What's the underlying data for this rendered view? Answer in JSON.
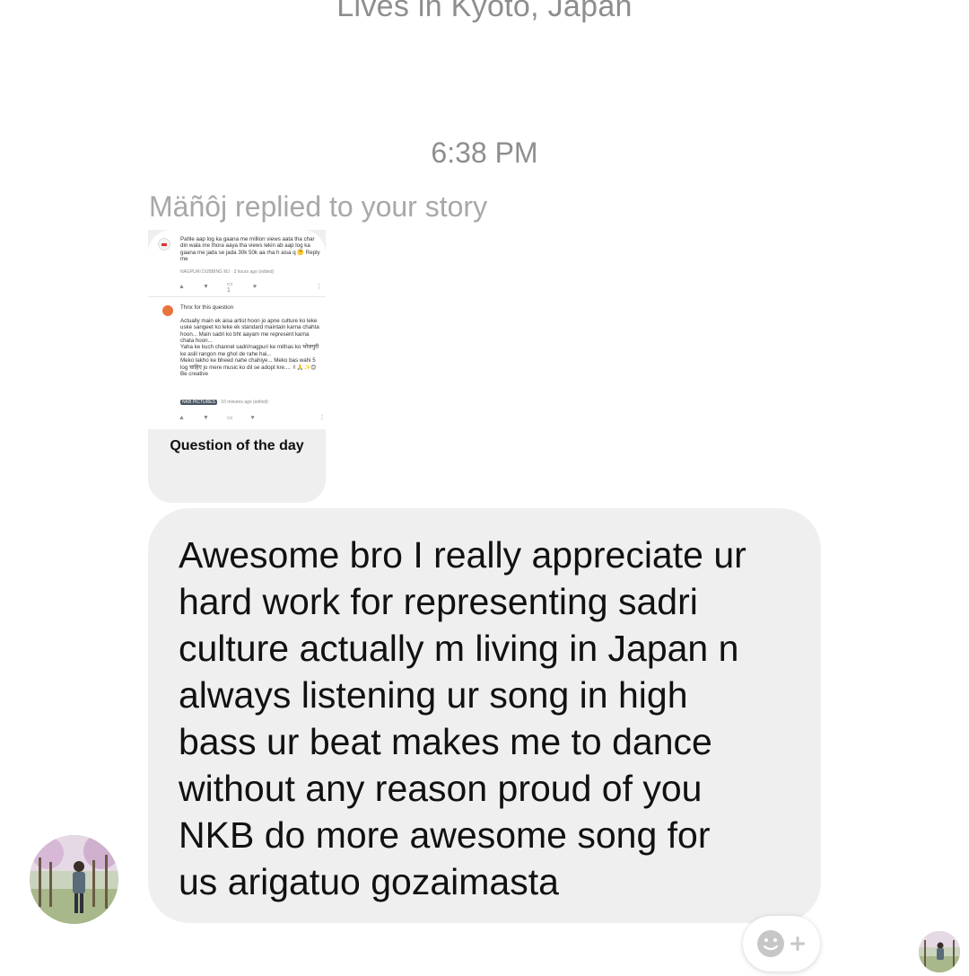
{
  "header": {
    "location": "Lives in Kyoto, Japan"
  },
  "thread": {
    "timestamp": "6:38 PM",
    "story_reply_notice": "Mäñôj replied to your story"
  },
  "story_preview": {
    "comment1": {
      "text": "Pahle aap log ka gaana me million views aata tha char din wala me thora aaya tha views  lekin ab aap log ka gaana me jada se jada 30k 50k aa rha h aisa q 🤔 Reply me",
      "meta": "NAGPURI DUBBING MJ · 3 hours ago (edited)",
      "reply_count": "1"
    },
    "comment2": {
      "text": "Thnx for this question\n\nActually main ek aisa artist hoon jo apne culture ko leke uske sangeet ko leke ek standard maintain karna chahta hoon... Main sadri ko bht aayam me represent karna chata hoon...\nYaha ke kuch channel sadri/nagpuri ke mithas ko भोजपुरी ke aslil rangon me ghol de rahe hai...\nMeko lakho ke bheed nahe chahiye... Meko bas wahi 5 log चाहिए jo mere music ko dil se adopt kre.... ✌🙏✨😊 Be creative",
      "author_tag": "NKB PICTURES",
      "meta": "· 10 minutes ago (edited)"
    },
    "caption": "Question of the day"
  },
  "message": {
    "text": "Awesome bro I really appreciate ur\nhard work for representing sadri\nculture actually m living in Japan n\nalways listening ur song in high\nbass ur beat makes me to dance\nwithout any reason proud of you\nNKB do more awesome song for\nus arigatuo gozaimasta"
  },
  "icons": {
    "sender_avatar": "avatar-photo",
    "seen_avatar": "avatar-photo",
    "reaction": "add-reaction-icon"
  }
}
